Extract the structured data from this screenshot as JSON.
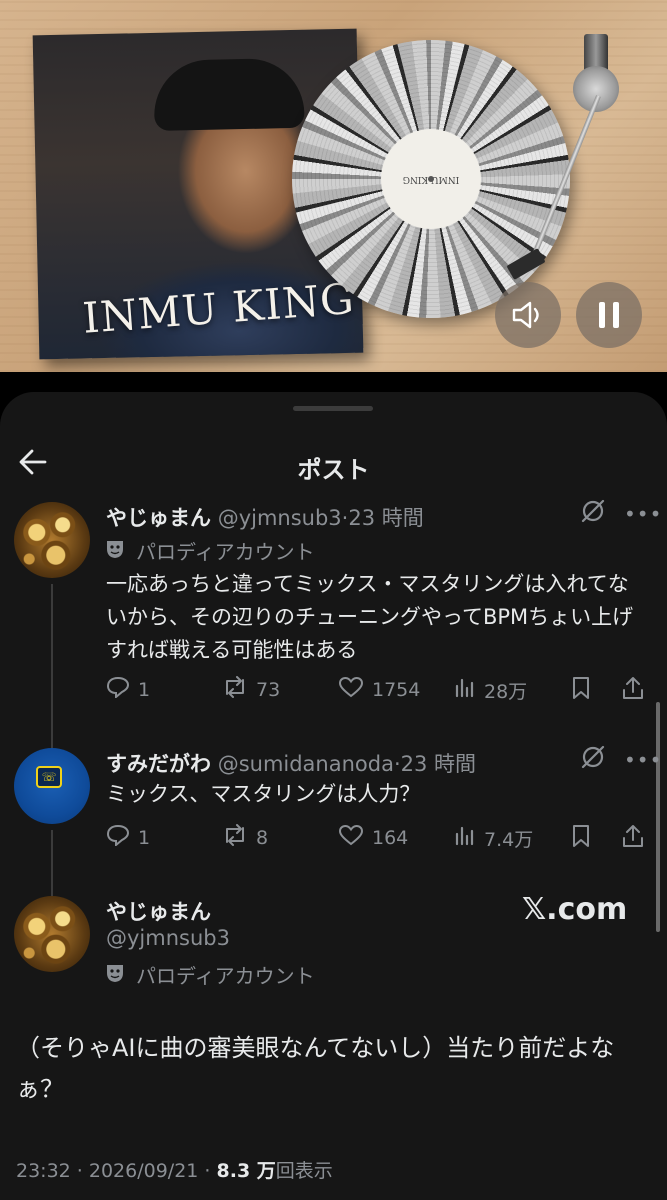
{
  "hero": {
    "album_title": "INMU KING",
    "vinyl_label": "INMU KING",
    "sound_icon": "speaker-icon",
    "pause_icon": "pause-icon"
  },
  "header": {
    "title": "ポスト",
    "back_icon": "arrow-left-icon"
  },
  "posts": [
    {
      "name": "やじゅまん",
      "handle": "@yjmnsub3",
      "separator": "·",
      "time": "23 時間",
      "badge": "パロディアカウント",
      "body": "一応あっちと違ってミックス・マスタリングは入れてないから、その辺りのチューニングやってBPMちょい上げすれば戦える可能性はある",
      "replies": "1",
      "reposts": "73",
      "likes": "1754",
      "views": "28万"
    },
    {
      "name": "すみだがわ",
      "handle": "@sumidananoda",
      "separator": "·",
      "time": "23 時間",
      "body": "ミックス、マスタリングは人力？",
      "replies": "1",
      "reposts": "8",
      "likes": "164",
      "views": "7.4万"
    }
  ],
  "main_post": {
    "name": "やじゅまん",
    "handle": "@yjmnsub3",
    "badge": "パロディアカウント",
    "watermark": "𝕏.com",
    "body": "（そりゃAIに曲の審美眼なんてないし）当たり前だよなぁ？",
    "timestamp": "23:32 · 2026/09/21 · ",
    "views_count": "8.3 万",
    "views_label": "回表示"
  },
  "colors": {
    "background": "#161616",
    "text": "#e7e9ea",
    "muted": "#8b8f94"
  }
}
